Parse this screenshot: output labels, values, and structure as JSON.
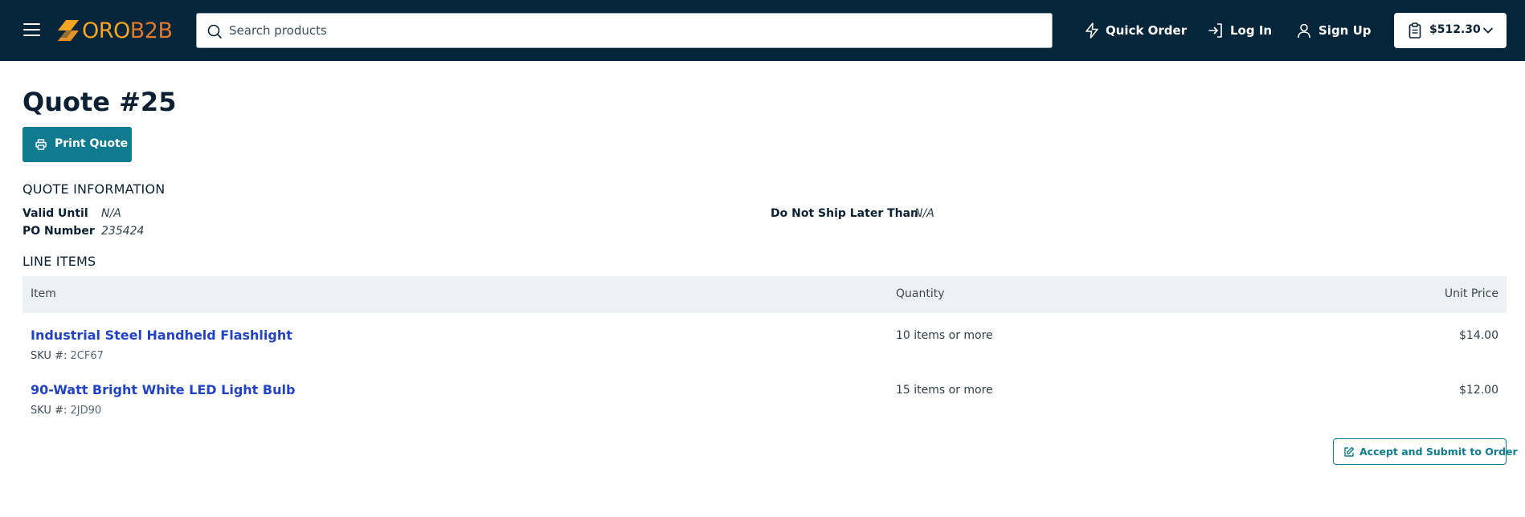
{
  "header": {
    "logo": {
      "part1": "ORO",
      "part2": "B2B"
    },
    "search": {
      "placeholder": "Search products",
      "value": ""
    },
    "nav": {
      "quick_order": "Quick Order",
      "log_in": "Log In",
      "sign_up": "Sign Up"
    },
    "cart": {
      "amount": "$512.30"
    }
  },
  "page": {
    "title": "Quote #25",
    "print_button": "Print Quote"
  },
  "quote_info": {
    "title": "QUOTE INFORMATION",
    "valid_until_label": "Valid Until",
    "valid_until_value": "N/A",
    "po_number_label": "PO Number",
    "po_number_value": "235424",
    "do_not_ship_label": "Do Not Ship Later Than",
    "do_not_ship_value": "N/A"
  },
  "line_items": {
    "title": "LINE ITEMS",
    "columns": {
      "item": "Item",
      "quantity": "Quantity",
      "unit_price": "Unit Price"
    },
    "rows": [
      {
        "name": "Industrial Steel Handheld Flashlight",
        "sku_label": "SKU #:",
        "sku": "2CF67",
        "quantity": "10 items or more",
        "price": "$14.00"
      },
      {
        "name": "90-Watt Bright White LED Light Bulb",
        "sku_label": "SKU #:",
        "sku": "2JD90",
        "quantity": "15 items or more",
        "price": "$12.00"
      }
    ]
  },
  "actions": {
    "accept_button": "Accept and Submit to Order"
  },
  "colors": {
    "header_bg": "#05253a",
    "accent": "#0f7b91",
    "link": "#2243c4",
    "logo_oro": "#f5a623",
    "logo_b2b": "#e07a2a"
  },
  "icons": {
    "menu": "hamburger-icon",
    "search": "search-icon",
    "quick_order": "lightning-icon",
    "log_in": "login-icon",
    "sign_up": "user-icon",
    "cart": "clipboard-icon",
    "cart_toggle": "chevron-down-icon",
    "print": "printer-icon",
    "accept": "edit-icon"
  }
}
